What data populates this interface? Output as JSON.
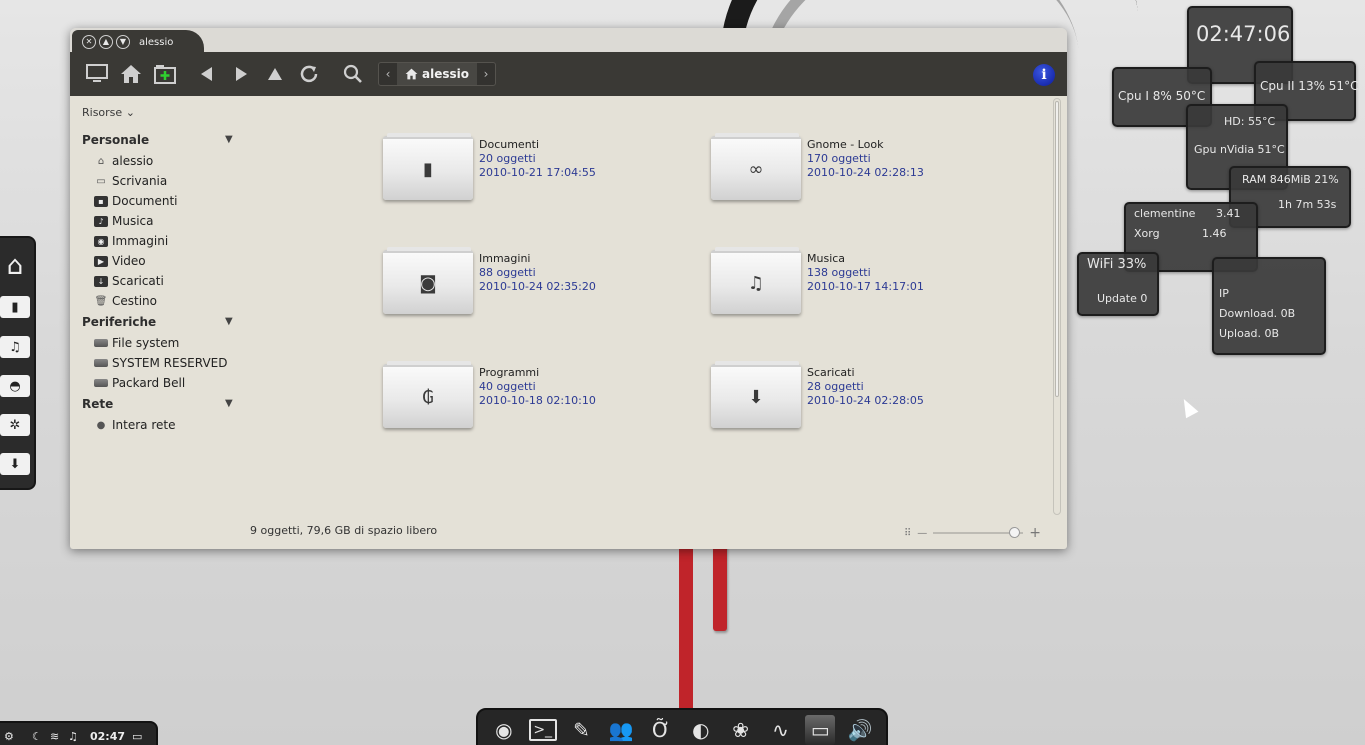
{
  "window": {
    "title": "alessio",
    "location": "alessio",
    "status": "9 oggetti, 79,6 GB di spazio libero"
  },
  "sidebar": {
    "resources_label": "Risorse",
    "sections": [
      {
        "title": "Personale",
        "items": [
          {
            "label": "alessio",
            "icon": "home-icon"
          },
          {
            "label": "Scrivania",
            "icon": "desktop-icon"
          },
          {
            "label": "Documenti",
            "icon": "documents-folder-icon"
          },
          {
            "label": "Musica",
            "icon": "music-folder-icon"
          },
          {
            "label": "Immagini",
            "icon": "pictures-folder-icon"
          },
          {
            "label": "Video",
            "icon": "videos-folder-icon"
          },
          {
            "label": "Scaricati",
            "icon": "downloads-folder-icon"
          },
          {
            "label": "Cestino",
            "icon": "trash-icon"
          }
        ]
      },
      {
        "title": "Periferiche",
        "items": [
          {
            "label": "File system",
            "icon": "drive-icon"
          },
          {
            "label": "SYSTEM RESERVED",
            "icon": "drive-icon"
          },
          {
            "label": "Packard Bell",
            "icon": "drive-icon"
          }
        ]
      },
      {
        "title": "Rete",
        "items": [
          {
            "label": "Intera rete",
            "icon": "network-icon"
          }
        ]
      }
    ]
  },
  "folders": [
    {
      "name": "Documenti",
      "count": "20 oggetti",
      "date": "2010-10-21 17:04:55",
      "icon": "document-icon"
    },
    {
      "name": "Gnome - Look",
      "count": "170 oggetti",
      "date": "2010-10-24 02:28:13",
      "icon": "rings-icon"
    },
    {
      "name": "Immagini",
      "count": "88 oggetti",
      "date": "2010-10-24 02:35:20",
      "icon": "camera-icon"
    },
    {
      "name": "Musica",
      "count": "138 oggetti",
      "date": "2010-10-17 14:17:01",
      "icon": "music-note-icon"
    },
    {
      "name": "Programmi",
      "count": "40 oggetti",
      "date": "2010-10-18 02:10:10",
      "icon": "program-icon"
    },
    {
      "name": "Scaricati",
      "count": "28 oggetti",
      "date": "2010-10-24 02:28:05",
      "icon": "download-arrow-icon"
    }
  ],
  "widgets": {
    "clock": "02:47:06",
    "cpu1": "Cpu I 8% 50°C",
    "cpu2": "Cpu II 13% 51°C",
    "hd": "HD: 55°C",
    "gpu": "Gpu nVidia 51°C",
    "ram": "RAM 846MiB  21%",
    "uptime": "1h 7m 53s",
    "proc1_name": "clementine",
    "proc1_val": "3.41",
    "proc2_name": "Xorg",
    "proc2_val": "1.46",
    "wifi": "WiFi 33%",
    "update": "Update 0",
    "ip": "IP",
    "download": "Download. 0B",
    "upload": "Upload. 0B"
  },
  "panel": {
    "time": "02:47"
  }
}
